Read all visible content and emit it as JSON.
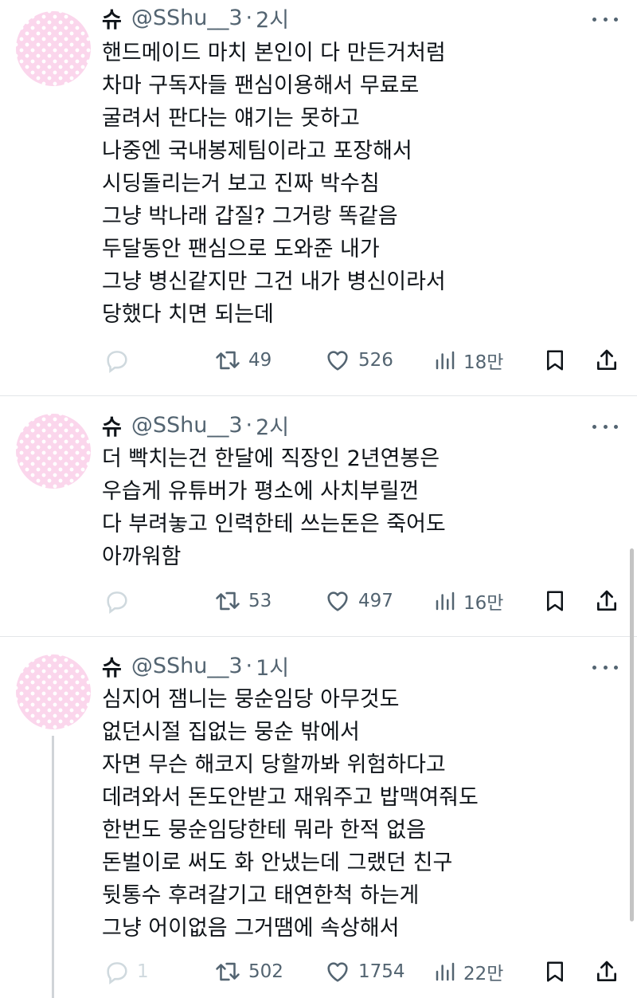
{
  "tweets": [
    {
      "name": "슈",
      "handle": "@SShu__3",
      "dot": "·",
      "time": "2시",
      "lines": [
        "핸드메이드 마치 본인이 다 만든거처럼",
        "차마 구독자들 팬심이용해서 무료로",
        "굴려서 판다는 얘기는 못하고",
        "나중엔 국내봉제팀이라고 포장해서",
        "시딩돌리는거 보고 진짜 박수침",
        "그냥 박나래 갑질? 그거랑 똑같음",
        "두달동안 팬심으로 도와준 내가",
        "그냥 병신같지만 그건 내가 병신이라서",
        "당했다 치면 되는데"
      ],
      "reply_count": "",
      "retweet_count": "49",
      "like_count": "526",
      "view_count": "18만"
    },
    {
      "name": "슈",
      "handle": "@SShu__3",
      "dot": "·",
      "time": "2시",
      "lines": [
        "더 빡치는건 한달에 직장인 2년연봉은",
        "우습게 유튜버가 평소에 사치부릴껀",
        "다 부려놓고 인력한테 쓰는돈은 죽어도",
        "아까워함"
      ],
      "reply_count": "",
      "retweet_count": "53",
      "like_count": "497",
      "view_count": "16만"
    },
    {
      "name": "슈",
      "handle": "@SShu__3",
      "dot": "·",
      "time": "1시",
      "lines": [
        "심지어 잼니는 뭉순임당 아무것도",
        "없던시절 집없는 뭉순 밖에서",
        "자면 무슨 해코지 당할까봐 위험하다고",
        "데려와서 돈도안받고 재워주고 밥맥여줘도",
        "한번도 뭉순임당한테 뭐라 한적 없음",
        "돈벌이로 써도 화 안냈는데 그랬던 친구",
        "뒷통수 후려갈기고 태연한척 하는게",
        "그냥 어이없음 그거땜에 속상해서"
      ],
      "reply_count": "1",
      "retweet_count": "502",
      "like_count": "1754",
      "view_count": "22만"
    }
  ],
  "icons": {
    "reply": "reply-icon",
    "retweet": "retweet-icon",
    "like": "heart-icon",
    "views": "views-icon",
    "bookmark": "bookmark-icon",
    "share": "share-icon",
    "more": "more-icon"
  },
  "colors": {
    "text": "#0f1419",
    "secondary": "#536471",
    "faint": "#cfd9de",
    "avatar": "#fbd6ec"
  }
}
